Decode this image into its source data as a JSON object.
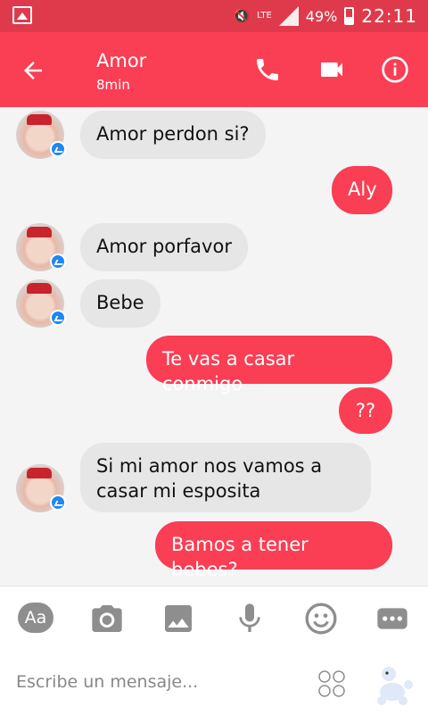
{
  "status_bar": {
    "network": "LTE",
    "battery": "49%",
    "time": "22:11"
  },
  "app_bar": {
    "title": "Amor",
    "subtitle": "8min"
  },
  "messages": [
    {
      "side": "in",
      "text": "Amor perdon si?"
    },
    {
      "side": "out",
      "text": "Aly"
    },
    {
      "side": "in",
      "text": "Amor porfavor"
    },
    {
      "side": "in",
      "text": "Bebe"
    },
    {
      "side": "out",
      "text": "Te vas a casar conmigo"
    },
    {
      "side": "out",
      "text": "??"
    },
    {
      "side": "in",
      "text": "Si mi amor nos vamos a casar mi esposita"
    },
    {
      "side": "out",
      "text": "Bamos a tener bebes?"
    }
  ],
  "composer": {
    "placeholder": "Escribe un mensaje...",
    "tool_aa": "Aa"
  },
  "colors": {
    "accent": "#fa3e54",
    "statusbar": "#df3a4c",
    "incoming": "#e6e6e6"
  },
  "icons": [
    "back-arrow-icon",
    "phone-icon",
    "video-icon",
    "info-icon",
    "camera-icon",
    "gallery-icon",
    "microphone-icon",
    "emoji-icon",
    "more-icon",
    "emoji-grid-icon",
    "sticker-icon"
  ]
}
